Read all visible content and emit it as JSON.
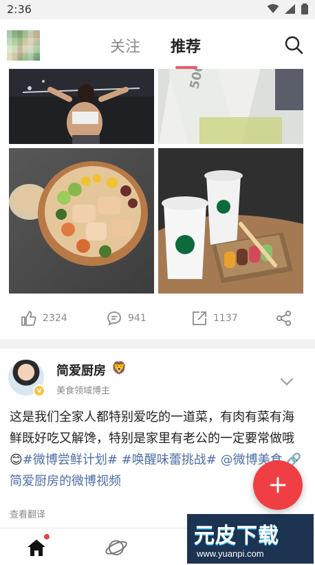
{
  "status_bar": {
    "time": "2:36"
  },
  "header": {
    "tab_follow": "关注",
    "tab_recommend": "推荐",
    "active_tab_color": "#f0556b"
  },
  "post_actions_prev": {
    "likes": "2324",
    "comments": "941",
    "reposts": "1137"
  },
  "post": {
    "author": "简爱厨房",
    "author_badge_emoji": "🦁",
    "author_subtitle": "美食领域博主",
    "verified_badge_icon": "v-badge-icon",
    "text_plain": "这是我们全家人都特别爱吃的一道菜，有肉有菜有海鲜既好吃又解馋，特别是家里有老公的一定要常做哦",
    "emoji_smile": "😊",
    "hashtag_1": "#微博尝鲜计划#",
    "hashtag_2": "#唤醒味蕾挑战#",
    "mention": "@微博美食",
    "video_link": "简爱厨房的微博视频",
    "translate": "查看翻译"
  },
  "watermark": {
    "title": "元皮下载",
    "url": "www.yuanpi.com"
  },
  "colors": {
    "link": "#4d6ea8",
    "fab": "#ef3f45",
    "notification_dot": "#ef3f45"
  }
}
